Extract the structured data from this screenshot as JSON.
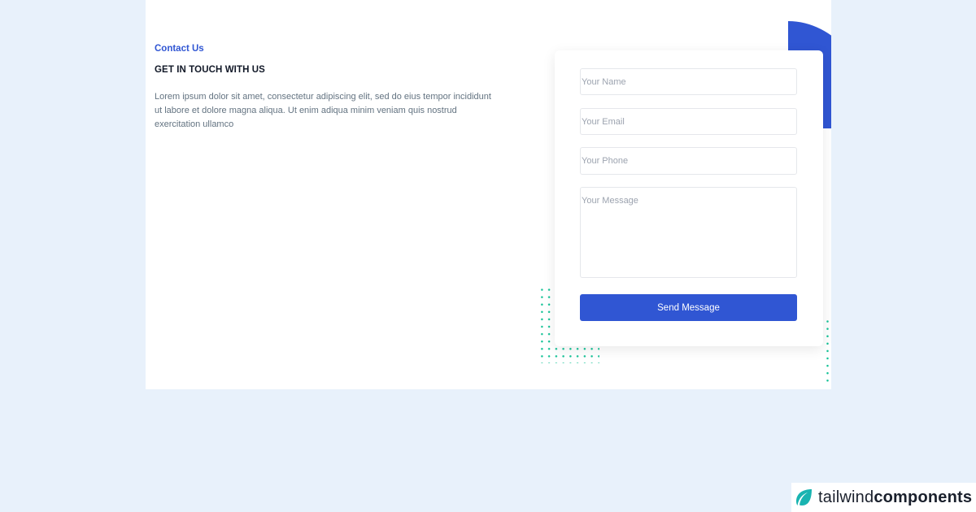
{
  "contact": {
    "label": "Contact Us",
    "heading": "GET IN TOUCH WITH US",
    "body": "Lorem ipsum dolor sit amet, consectetur adipiscing elit, sed do eius tempor incididunt ut labore et dolore magna aliqua. Ut enim adiqua minim veniam quis nostrud exercitation ullamco"
  },
  "form": {
    "name_placeholder": "Your Name",
    "email_placeholder": "Your Email",
    "phone_placeholder": "Your Phone",
    "message_placeholder": "Your Message",
    "submit_label": "Send Message"
  },
  "brand": {
    "name_light": "tailwind",
    "name_bold": "components",
    "icon": "leaf-icon"
  },
  "colors": {
    "accent": "#3056d3",
    "dots": "#13c296",
    "page_background": "#e8f1fb"
  }
}
